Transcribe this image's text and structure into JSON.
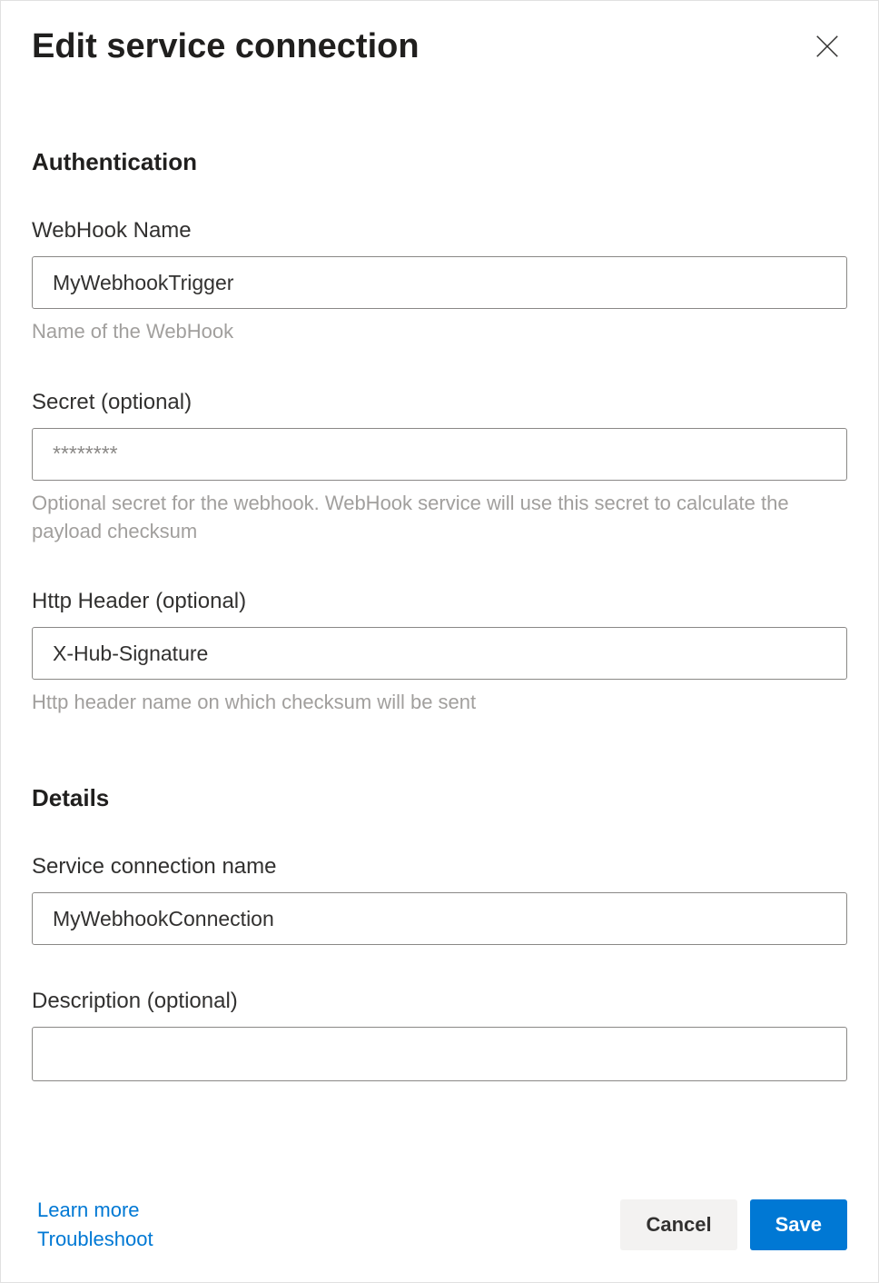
{
  "header": {
    "title": "Edit service connection"
  },
  "sections": {
    "auth": {
      "heading": "Authentication",
      "fields": {
        "webhook_name": {
          "label": "WebHook Name",
          "value": "MyWebhookTrigger",
          "help": "Name of the WebHook"
        },
        "secret": {
          "label": "Secret (optional)",
          "value": "",
          "placeholder": "********",
          "help": "Optional secret for the webhook. WebHook service will use this secret to calculate the payload checksum"
        },
        "http_header": {
          "label": "Http Header (optional)",
          "value": "X-Hub-Signature",
          "help": "Http header name on which checksum will be sent"
        }
      }
    },
    "details": {
      "heading": "Details",
      "fields": {
        "service_connection_name": {
          "label": "Service connection name",
          "value": "MyWebhookConnection"
        },
        "description": {
          "label": "Description (optional)",
          "value": ""
        }
      }
    }
  },
  "footer": {
    "links": {
      "learn_more": "Learn more",
      "troubleshoot": "Troubleshoot"
    },
    "buttons": {
      "cancel": "Cancel",
      "save": "Save"
    }
  }
}
